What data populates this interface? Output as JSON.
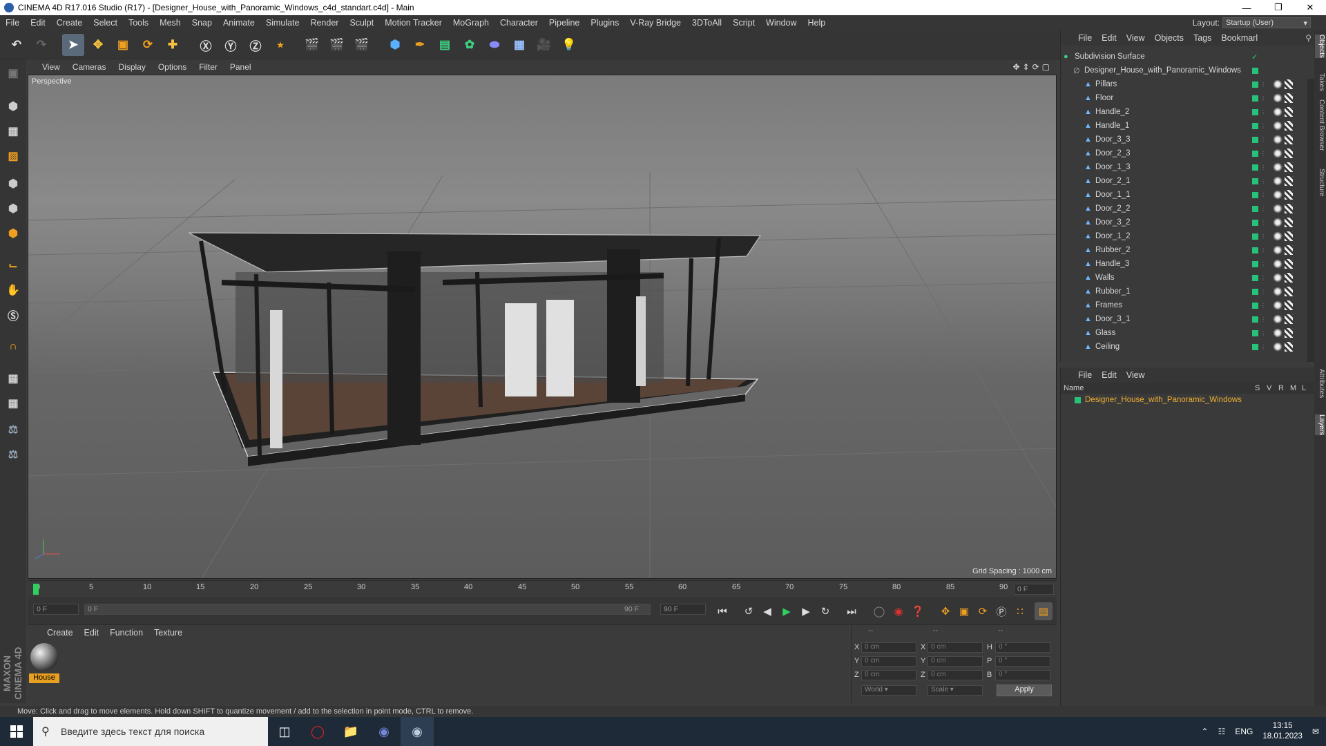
{
  "window": {
    "title": "CINEMA 4D R17.016 Studio (R17) - [Designer_House_with_Panoramic_Windows_c4d_standart.c4d] - Main"
  },
  "menubar": {
    "items": [
      "File",
      "Edit",
      "Create",
      "Select",
      "Tools",
      "Mesh",
      "Snap",
      "Animate",
      "Simulate",
      "Render",
      "Sculpt",
      "Motion Tracker",
      "MoGraph",
      "Character",
      "Pipeline",
      "Plugins",
      "V-Ray Bridge",
      "3DToAll",
      "Script",
      "Window",
      "Help"
    ],
    "layout_label": "Layout:",
    "layout_value": "Startup (User)"
  },
  "viewport": {
    "menu": [
      "View",
      "Cameras",
      "Display",
      "Options",
      "Filter",
      "Panel"
    ],
    "label": "Perspective",
    "grid_spacing": "Grid Spacing : 1000 cm"
  },
  "timeline": {
    "ticks": [
      "0",
      "5",
      "10",
      "15",
      "20",
      "25",
      "30",
      "35",
      "40",
      "45",
      "50",
      "55",
      "60",
      "65",
      "70",
      "75",
      "80",
      "85",
      "90"
    ],
    "end_field": "0 F"
  },
  "transport": {
    "start_field": "0 F",
    "range_start": "0 F",
    "range_end": "90 F",
    "end_field": "90 F"
  },
  "materials": {
    "menu": [
      "Create",
      "Edit",
      "Function",
      "Texture"
    ],
    "swatch_label": "House"
  },
  "coords": {
    "rows": [
      {
        "a": "X",
        "av": "0 cm",
        "b": "X",
        "bv": "0 cm",
        "c": "H",
        "cv": "0 °"
      },
      {
        "a": "Y",
        "av": "0 cm",
        "b": "Y",
        "bv": "0 cm",
        "c": "P",
        "cv": "0 °"
      },
      {
        "a": "Z",
        "av": "0 cm",
        "b": "Z",
        "bv": "0 cm",
        "c": "B",
        "cv": "0 °"
      }
    ],
    "dashes": [
      "--",
      "--",
      "--"
    ],
    "world": "World",
    "scale": "Scale",
    "apply": "Apply"
  },
  "objects": {
    "menu": [
      "File",
      "Edit",
      "View",
      "Objects",
      "Tags",
      "Bookmarl"
    ],
    "root": "Subdivision Surface",
    "group": "Designer_House_with_Panoramic_Windows",
    "items": [
      "Pillars",
      "Floor",
      "Handle_2",
      "Handle_1",
      "Door_3_3",
      "Door_2_3",
      "Door_1_3",
      "Door_2_1",
      "Door_1_1",
      "Door_2_2",
      "Door_3_2",
      "Door_1_2",
      "Rubber_2",
      "Handle_3",
      "Walls",
      "Rubber_1",
      "Frames",
      "Door_3_1",
      "Glass",
      "Ceiling"
    ]
  },
  "layers": {
    "menu": [
      "File",
      "Edit",
      "View"
    ],
    "header_name": "Name",
    "header_flags": [
      "S",
      "V",
      "R",
      "M",
      "L"
    ],
    "row": "Designer_House_with_Panoramic_Windows"
  },
  "right_tabs": [
    "Objects",
    "Takes",
    "Content Browser",
    "Structure",
    "Attributes",
    "Layers"
  ],
  "statusbar": {
    "text": "Move: Click and drag to move elements. Hold down SHIFT to quantize movement / add to the selection in point mode, CTRL to remove."
  },
  "brand": "MAXON CINEMA 4D",
  "taskbar": {
    "search_placeholder": "Введите здесь текст для поиска",
    "lang": "ENG",
    "time": "13:15",
    "date": "18.01.2023"
  }
}
